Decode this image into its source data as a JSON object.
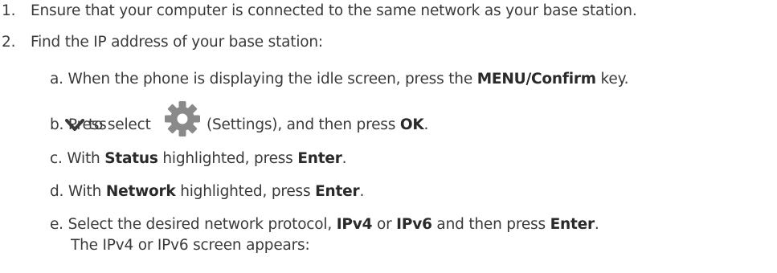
{
  "steps": [
    {
      "number": "1.",
      "text": "Ensure that your computer is connected to the same network as your base station."
    },
    {
      "number": "2.",
      "text": "Find the IP address of your base station:"
    }
  ],
  "substeps": {
    "a": {
      "label": "a.",
      "pre": "When the phone is displaying the idle screen, press the ",
      "key": "MENU/Confirm",
      "post": " key."
    },
    "b": {
      "label": "b.",
      "pre": "Press ",
      "mid": " to select ",
      "post1": " (Settings), and then press ",
      "key": "OK",
      "post2": "."
    },
    "c": {
      "label": "c.",
      "pre": "With ",
      "item": "Status",
      "mid": " highlighted, press ",
      "key": "Enter",
      "post": "."
    },
    "d": {
      "label": "d.",
      "pre": "With ",
      "item": "Network",
      "mid": " highlighted, press ",
      "key": "Enter",
      "post": "."
    },
    "e": {
      "label": "e.",
      "pre": "Select the desired network protocol, ",
      "opt1": "IPv4",
      "or": " or ",
      "opt2": "IPv6",
      "mid": " and then press ",
      "key": "Enter",
      "post": ".",
      "line2": "The IPv4 or IPv6 screen appears:"
    }
  },
  "icons": {
    "down": "chevron-down-icon",
    "settings": "gear-icon"
  },
  "colors": {
    "text": "#3a3a3a",
    "icon": "#8a8a8a"
  }
}
